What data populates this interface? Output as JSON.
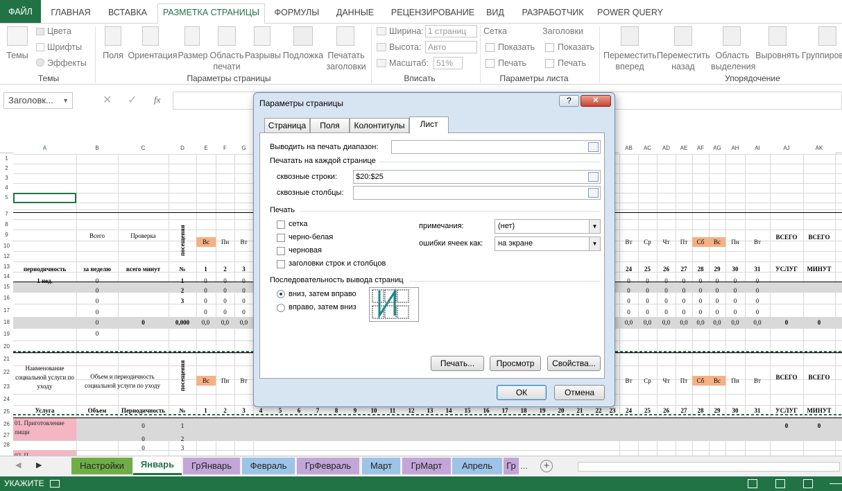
{
  "ribbon_tabs": {
    "file": "ФАЙЛ",
    "home": "ГЛАВНАЯ",
    "insert": "ВСТАВКА",
    "page_layout": "РАЗМЕТКА СТРАНИЦЫ",
    "formulas": "ФОРМУЛЫ",
    "data": "ДАННЫЕ",
    "review": "РЕЦЕНЗИРОВАНИЕ",
    "view": "ВИД",
    "developer": "РАЗРАБОТЧИК",
    "power_query": "POWER QUERY"
  },
  "ribbon": {
    "themes": "Темы",
    "colors": "Цвета",
    "fonts": "Шрифты",
    "effects": "Эффекты",
    "group_themes": "Темы",
    "margins": "Поля",
    "orientation": "Ориентация",
    "size": "Размер",
    "print_area_1": "Область",
    "print_area_2": "печати",
    "breaks": "Разрывы",
    "background": "Подложка",
    "print_titles_1": "Печатать",
    "print_titles_2": "заголовки",
    "group_page_setup": "Параметры страницы",
    "width_label": "Ширина:",
    "width_value": "1 страниц",
    "height_label": "Высота:",
    "height_value": "Авто",
    "scale_label": "Масштаб:",
    "scale_value": "51%",
    "group_fit": "Вписать",
    "gridlines": "Сетка",
    "headings": "Заголовки",
    "show": "Показать",
    "print": "Печать",
    "group_sheet_options": "Параметры листа",
    "bring_forward_1": "Переместить",
    "bring_forward_2": "вперед",
    "send_backward_1": "Переместить",
    "send_backward_2": "назад",
    "selection_pane_1": "Область",
    "selection_pane_2": "выделения",
    "align": "Выровнять",
    "group": "Группиров",
    "group_arrange": "Упорядочение"
  },
  "formula_bar": {
    "name_box": "Заголовк...",
    "fx": "fx",
    "cancel_glyph": "✕",
    "enter_glyph": "✓"
  },
  "columns": [
    "A",
    "B",
    "C",
    "D",
    "E",
    "F",
    "G",
    "AB",
    "AC",
    "AD",
    "AE",
    "AF",
    "AG",
    "AH",
    "AI",
    "AJ",
    "AK"
  ],
  "rows": [
    "1",
    "2",
    "3",
    "4",
    "5",
    "7",
    "8",
    "9",
    "10",
    "12",
    "13",
    "14",
    "15",
    "16",
    "17",
    "18",
    "19",
    "20",
    "21",
    "22",
    "23",
    "24",
    "25",
    "26",
    "27",
    "28"
  ],
  "sheet": {
    "hdr_total": "Всего",
    "hdr_check": "Проверка",
    "hdr_visits": "посещения",
    "hdr_period": "периодичность",
    "hdr_per_week": "за неделю",
    "hdr_total_minutes": "всего минут",
    "hdr_no": "№",
    "week1": "1 нед.",
    "total_services": "ВСЕГО",
    "total_minutes": "ВСЕГО",
    "services": "УСЛУГ",
    "minutes": "МИНУТ",
    "svc_name": "Наименование социальной услуги по уходу",
    "svc_volume_period": "Объем и периодичность социальной услуги по уходу",
    "svc": "Услуга",
    "volume": "Объем",
    "periodicity": "Периодичность",
    "svc_item": "01. Приготовление пищи",
    "svc_item_next": "02. П",
    "zero": "0",
    "zero_dec": "0,0",
    "zero_3": "0,000",
    "days_left": [
      "Вс",
      "Пн",
      "Вт"
    ],
    "days_right": [
      "Вт",
      "Ср",
      "Чт",
      "Пт",
      "Сб",
      "Вс",
      "Пн",
      "Вт"
    ],
    "nums_left": [
      "1",
      "2",
      "3"
    ],
    "nums_right": [
      "24",
      "25",
      "26",
      "27",
      "28",
      "29",
      "30",
      "31"
    ],
    "nums_bottom_mid": [
      "4",
      "5",
      "6",
      "7",
      "8",
      "9",
      "10",
      "11",
      "12",
      "13",
      "14",
      "15",
      "16",
      "17",
      "18",
      "19",
      "20",
      "21",
      "22",
      "23"
    ],
    "row_num": [
      "1",
      "2",
      "3"
    ],
    "colors": {
      "weekend": "#f4b183",
      "service": "#f4b6c2",
      "subtotal": "#d9d9d9"
    }
  },
  "sheet_tabs": [
    {
      "label": "Настройки",
      "color": "#70ad47"
    },
    {
      "label": "Январь",
      "color": "#ffffff"
    },
    {
      "label": "ГрЯнварь",
      "color": "#c3a6d8"
    },
    {
      "label": "Февраль",
      "color": "#9dc3e6"
    },
    {
      "label": "ГрФевраль",
      "color": "#c3a6d8"
    },
    {
      "label": "Март",
      "color": "#9dc3e6"
    },
    {
      "label": "ГрМарт",
      "color": "#c3a6d8"
    },
    {
      "label": "Апрель",
      "color": "#9dc3e6"
    },
    {
      "label": "Гр",
      "color": "#c3a6d8"
    }
  ],
  "sheet_tabs_more": "...",
  "status": {
    "mode": "УКАЖИТЕ"
  },
  "dialog": {
    "title": "Параметры страницы",
    "help": "?",
    "close": "✕",
    "tabs": [
      "Страница",
      "Поля",
      "Колонтитулы",
      "Лист"
    ],
    "print_area_label": "Выводить на печать диапазон:",
    "print_area_value": "",
    "print_titles_section": "Печатать на каждой странице",
    "rows_repeat_label": "сквозные строки:",
    "rows_repeat_value": "$20:$25",
    "cols_repeat_label": "сквозные столбцы:",
    "cols_repeat_value": "",
    "print_section": "Печать",
    "cb_gridlines": "сетка",
    "cb_bw": "черно-белая",
    "cb_draft": "черновая",
    "cb_headings": "заголовки строк и столбцов",
    "comments_label": "примечания:",
    "comments_value": "(нет)",
    "errors_label": "ошибки ячеек как:",
    "errors_value": "на экране",
    "order_section": "Последовательность вывода страниц",
    "order_down": "вниз, затем вправо",
    "order_over": "вправо, затем вниз",
    "btn_print": "Печать...",
    "btn_preview": "Просмотр",
    "btn_props": "Свойства...",
    "btn_ok": "ОК",
    "btn_cancel": "Отмена"
  }
}
